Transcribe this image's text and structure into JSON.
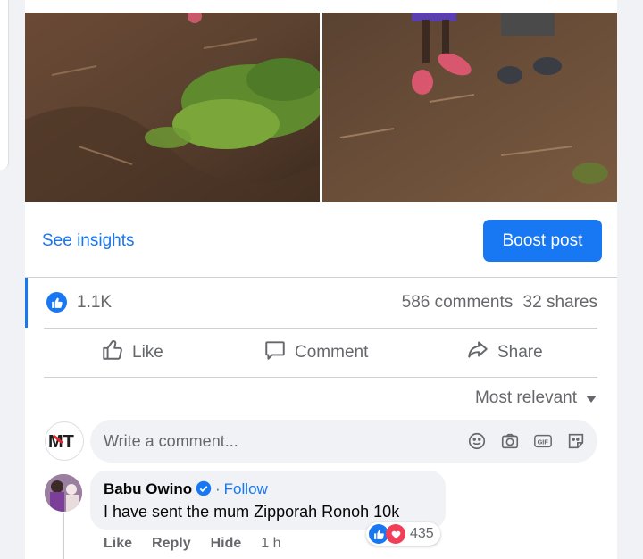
{
  "post": {
    "see_insights_label": "See insights",
    "boost_label": "Boost post",
    "reaction_count": "1.1K",
    "comments_count": "586 comments",
    "shares_count": "32 shares",
    "actions": {
      "like": "Like",
      "comment": "Comment",
      "share": "Share"
    }
  },
  "comments": {
    "sort_label": "Most relevant",
    "input_placeholder": "Write a comment...",
    "composer_page_logo_text": "MT",
    "items": [
      {
        "author": "Babu Owino",
        "verified": true,
        "follow_label": "Follow",
        "text": "I have sent the mum Zipporah Ronoh 10k",
        "reaction_count": "435",
        "actions": {
          "like": "Like",
          "reply": "Reply",
          "hide": "Hide"
        },
        "time": "1 h"
      }
    ]
  },
  "icons": [
    "like-badge-icon",
    "thumbs-up-icon",
    "comment-icon",
    "share-icon",
    "caret-down-icon",
    "emoji-icon",
    "camera-icon",
    "gif-icon",
    "sticker-icon",
    "verified-icon",
    "love-icon"
  ],
  "colors": {
    "accent": "#1877f2",
    "love": "#f33e58",
    "muted": "#65676b",
    "bubble": "#f0f2f5"
  }
}
